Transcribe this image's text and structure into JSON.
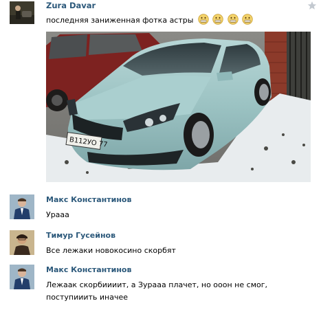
{
  "post": {
    "author": "Zura Davar",
    "text": "последняя заниженная фотка астры",
    "smiles": [
      "grimace-smile-icon",
      "grimace-smile-icon",
      "grimace-smile-icon",
      "grimace-smile-icon"
    ],
    "photo": {
      "plate": "В 112УО 77",
      "icon": "car-photo"
    }
  },
  "comments": [
    {
      "author": "Макс Константинов",
      "text": "Урааа"
    },
    {
      "author": "Тимур Гусейнов",
      "text": "Все лежаки новокосино скорбят"
    },
    {
      "author": "Макс Константинов",
      "text": "Лежаак скорбиииит, а Зурааа плачет, но ооон не смог, поступииить иначее"
    }
  ],
  "colors": {
    "link": "#2b587a",
    "car": "#9fc7c6"
  }
}
